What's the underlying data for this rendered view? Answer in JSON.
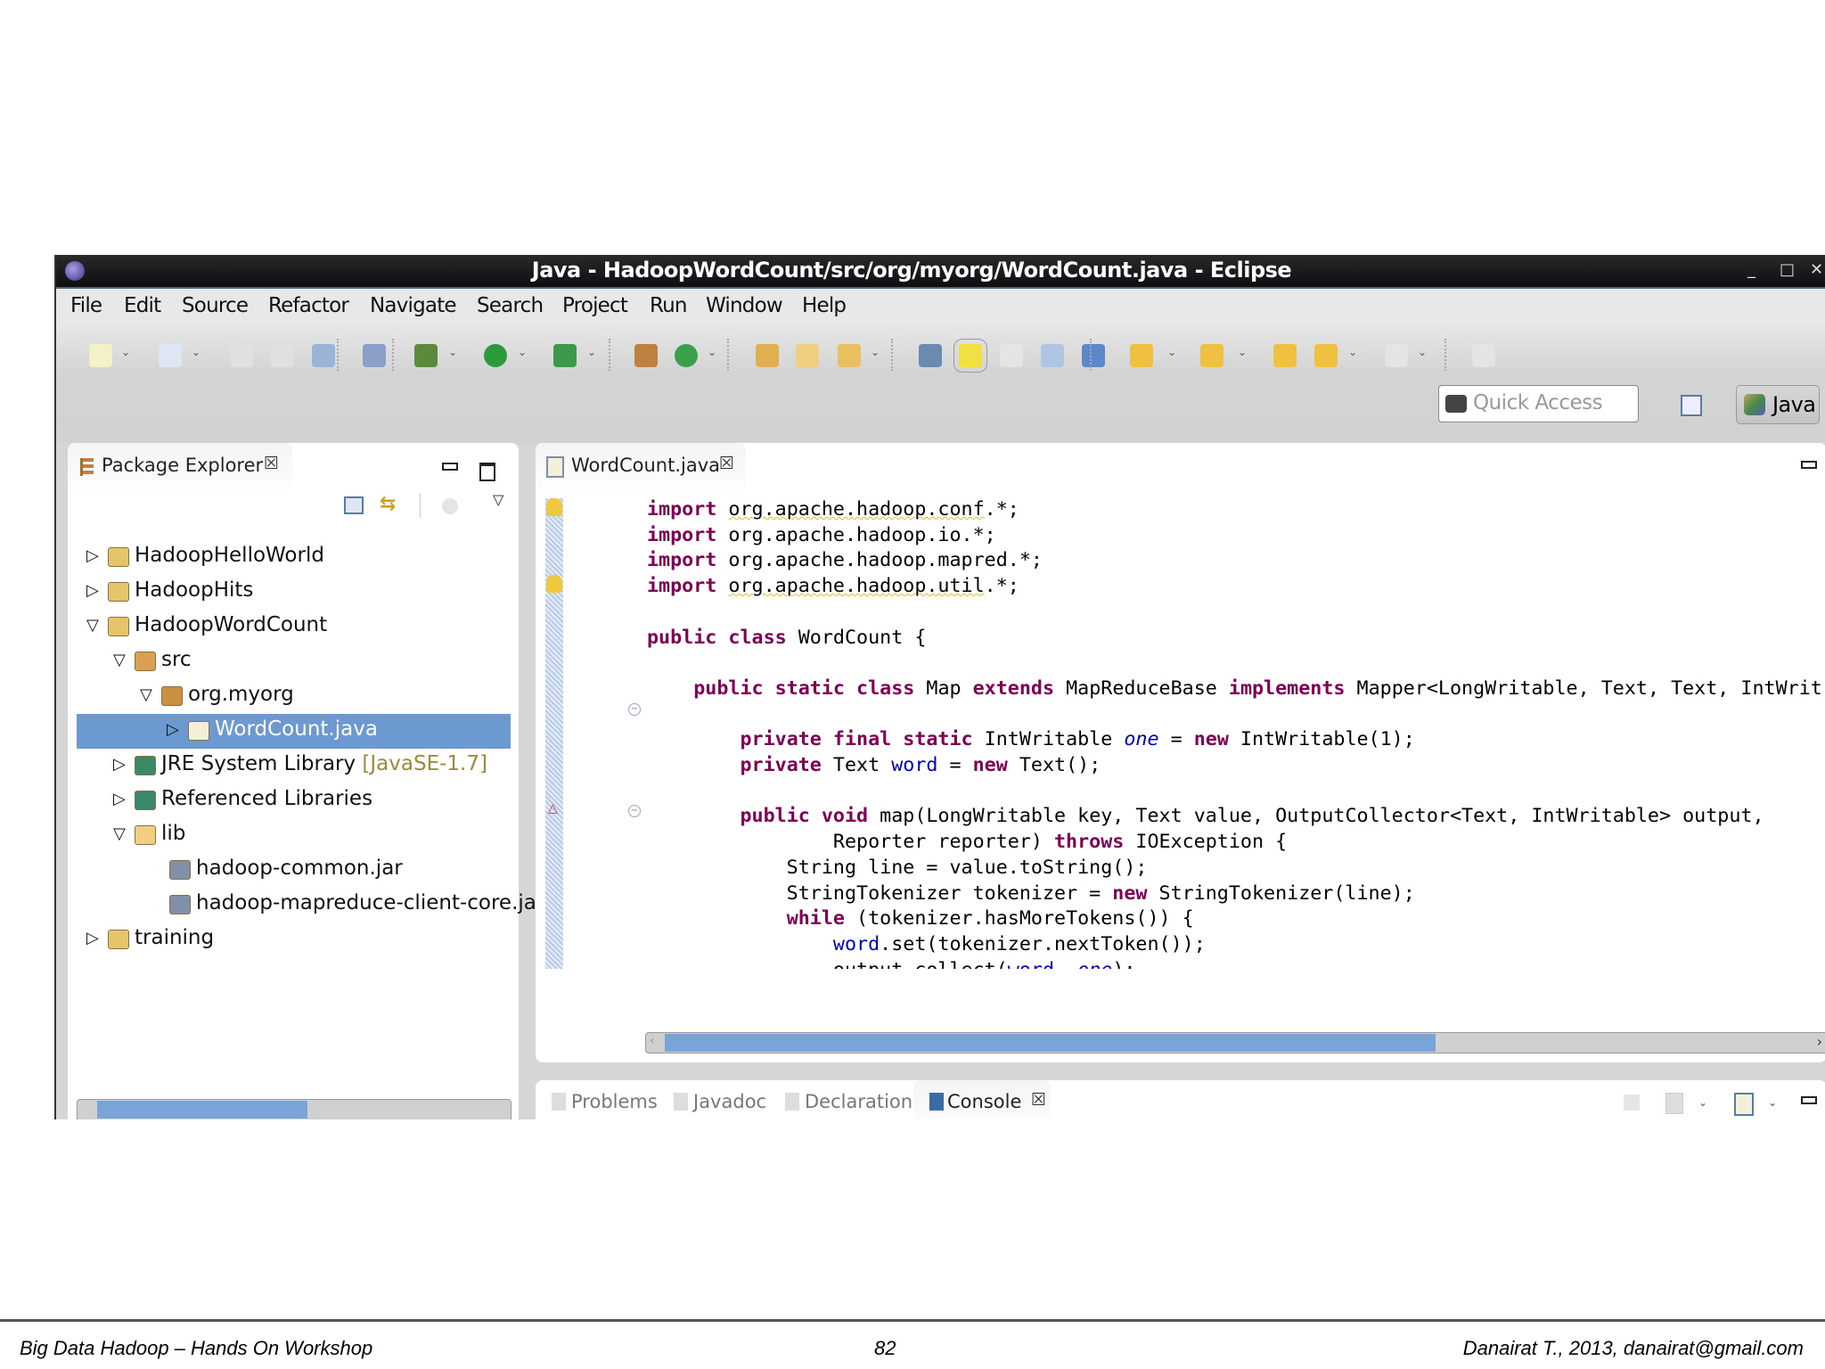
{
  "window": {
    "title": "Java - HadoopWordCount/src/org/myorg/WordCount.java - Eclipse",
    "controls": [
      "_",
      "□",
      "✕"
    ]
  },
  "menu": [
    "File",
    "Edit",
    "Source",
    "Refactor",
    "Navigate",
    "Search",
    "Project",
    "Run",
    "Window",
    "Help"
  ],
  "toolbar": {
    "icons": [
      "new-icon",
      "new-dropdown",
      "open-type-icon",
      "open-type-dropdown",
      "save-icon",
      "save-all-icon",
      "print-icon",
      "skip-breakpoints-icon",
      "debug-icon",
      "debug-dropdown",
      "run-icon",
      "run-dropdown",
      "external-tools-icon",
      "external-tools-dropdown",
      "new-package-icon",
      "new-class-icon",
      "new-class-dropdown",
      "open-project-icon",
      "open-folder-icon",
      "search-icon",
      "search-dropdown",
      "open-task-icon",
      "toggle-mark-occurrences-icon",
      "toggle-block-selection-icon",
      "show-javadoc-icon",
      "show-whitespace-icon",
      "next-annotation-icon",
      "next-annotation-dropdown",
      "previous-annotation-icon",
      "previous-annotation-dropdown",
      "last-edit-location-icon",
      "back-icon",
      "back-dropdown",
      "forward-icon",
      "forward-dropdown",
      "pin-editor-icon"
    ],
    "quick_access_placeholder": "Quick Access",
    "perspective_label": "Java"
  },
  "package_explorer": {
    "tab_label": "Package Explorer",
    "tree": [
      {
        "label": "HadoopHelloWorld",
        "level": 0,
        "state": "collapsed",
        "icon": "java-project-icon"
      },
      {
        "label": "HadoopHits",
        "level": 0,
        "state": "collapsed",
        "icon": "java-project-icon"
      },
      {
        "label": "HadoopWordCount",
        "level": 0,
        "state": "expanded",
        "icon": "java-project-icon"
      },
      {
        "label": "src",
        "level": 1,
        "state": "expanded",
        "icon": "source-folder-icon"
      },
      {
        "label": "org.myorg",
        "level": 2,
        "state": "expanded",
        "icon": "package-icon"
      },
      {
        "label": "WordCount.java",
        "level": 3,
        "state": "collapsed",
        "icon": "java-file-icon",
        "selected": true
      },
      {
        "label": "JRE System Library",
        "decoration": " [JavaSE-1.7]",
        "level": 1,
        "state": "collapsed",
        "icon": "library-icon"
      },
      {
        "label": "Referenced Libraries",
        "level": 1,
        "state": "collapsed",
        "icon": "library-icon"
      },
      {
        "label": "lib",
        "level": 1,
        "state": "expanded",
        "icon": "folder-icon"
      },
      {
        "label": "hadoop-common.jar",
        "level": 2,
        "state": "leaf",
        "icon": "jar-icon"
      },
      {
        "label": "hadoop-mapreduce-client-core.jar",
        "level": 2,
        "state": "leaf",
        "icon": "jar-icon"
      },
      {
        "label": "training",
        "level": 0,
        "state": "collapsed",
        "icon": "java-project-icon"
      }
    ]
  },
  "editor": {
    "tab_label": "WordCount.java",
    "lines": [
      [
        [
          "kw",
          "import"
        ],
        [
          "p",
          " "
        ],
        [
          "warn",
          "org.apache.hadoop.conf"
        ],
        [
          "p",
          ".*;"
        ]
      ],
      [
        [
          "kw",
          "import"
        ],
        [
          "p",
          " org.apache.hadoop.io.*;"
        ]
      ],
      [
        [
          "kw",
          "import"
        ],
        [
          "p",
          " org.apache.hadoop.mapred.*;"
        ]
      ],
      [
        [
          "kw",
          "import"
        ],
        [
          "p",
          " "
        ],
        [
          "warn",
          "org.apache.hadoop.util"
        ],
        [
          "p",
          ".*;"
        ]
      ],
      [],
      [
        [
          "kw",
          "public class"
        ],
        [
          "p",
          " WordCount {"
        ]
      ],
      [],
      [
        [
          "p",
          "    "
        ],
        [
          "kw",
          "public static class"
        ],
        [
          "p",
          " Map "
        ],
        [
          "kw",
          "extends"
        ],
        [
          "p",
          " MapReduceBase "
        ],
        [
          "kw",
          "implements"
        ],
        [
          "p",
          " Mapper<LongWritable, Text, Text, IntWrit"
        ]
      ],
      [],
      [
        [
          "p",
          "        "
        ],
        [
          "kw",
          "private final static"
        ],
        [
          "p",
          " IntWritable "
        ],
        [
          "fldi",
          "one"
        ],
        [
          "p",
          " = "
        ],
        [
          "kw",
          "new"
        ],
        [
          "p",
          " IntWritable(1);"
        ]
      ],
      [
        [
          "p",
          "        "
        ],
        [
          "kw",
          "private"
        ],
        [
          "p",
          " Text "
        ],
        [
          "fld",
          "word"
        ],
        [
          "p",
          " = "
        ],
        [
          "kw",
          "new"
        ],
        [
          "p",
          " Text();"
        ]
      ],
      [],
      [
        [
          "p",
          "        "
        ],
        [
          "kw",
          "public void"
        ],
        [
          "p",
          " map(LongWritable key, Text value, OutputCollector<Text, IntWritable> output,"
        ]
      ],
      [
        [
          "p",
          "                Reporter reporter) "
        ],
        [
          "kw",
          "throws"
        ],
        [
          "p",
          " IOException {"
        ]
      ],
      [
        [
          "p",
          "            String line = value.toString();"
        ]
      ],
      [
        [
          "p",
          "            StringTokenizer tokenizer = "
        ],
        [
          "kw",
          "new"
        ],
        [
          "p",
          " StringTokenizer(line);"
        ]
      ],
      [
        [
          "p",
          "            "
        ],
        [
          "kw",
          "while"
        ],
        [
          "p",
          " (tokenizer.hasMoreTokens()) {"
        ]
      ],
      [
        [
          "p",
          "                "
        ],
        [
          "fld",
          "word"
        ],
        [
          "p",
          ".set(tokenizer.nextToken());"
        ]
      ],
      [
        [
          "p",
          "                output.collect("
        ],
        [
          "fld",
          "word"
        ],
        [
          "p",
          ", "
        ],
        [
          "fldi",
          "one"
        ],
        [
          "p",
          ");"
        ]
      ],
      [
        [
          "p",
          "            }"
        ]
      ],
      [
        [
          "p",
          "        }"
        ]
      ]
    ],
    "horizontal_scroll_fraction": 0.5,
    "vertical_scroll_fraction": 0.1
  },
  "bottom_panel": {
    "tabs": [
      {
        "label": "Problems",
        "icon": "problems-icon"
      },
      {
        "label": "Javadoc",
        "icon": "javadoc-icon"
      },
      {
        "label": "Declaration",
        "icon": "declaration-icon"
      },
      {
        "label": "Console",
        "icon": "console-icon",
        "selected": true
      }
    ]
  },
  "footer": {
    "left": "Big Data Hadoop – Hands On Workshop",
    "page": "82",
    "right": "Danairat T., 2013, danairat@gmail.com"
  },
  "colors": {
    "keyword": "#7f0055",
    "field": "#0000c0",
    "selection": "#6b99d0",
    "scroll_thumb": "#7aa3d8"
  }
}
